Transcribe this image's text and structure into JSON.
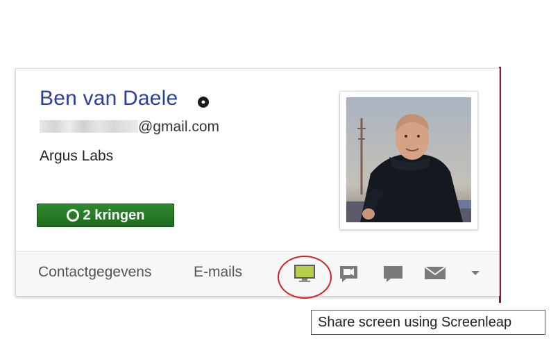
{
  "profile": {
    "name": "Ben van Daele",
    "email_domain": "@gmail.com",
    "organization": "Argus Labs",
    "circles_label": "2 kringen"
  },
  "actions": {
    "contact_info": "Contactgegevens",
    "emails": "E-mails",
    "icons": [
      "screenleap-share-icon",
      "video-chat-icon",
      "chat-icon",
      "mail-icon",
      "more-dropdown-icon"
    ]
  },
  "tooltip": {
    "text": "Share screen using Screenleap"
  },
  "colors": {
    "name_link": "#2a3f9d",
    "circles_button": "#2f8a2f",
    "highlight_ring": "#d62020",
    "screen_icon": "#b5cf4a",
    "icon_gray": "#7a7a7a"
  }
}
